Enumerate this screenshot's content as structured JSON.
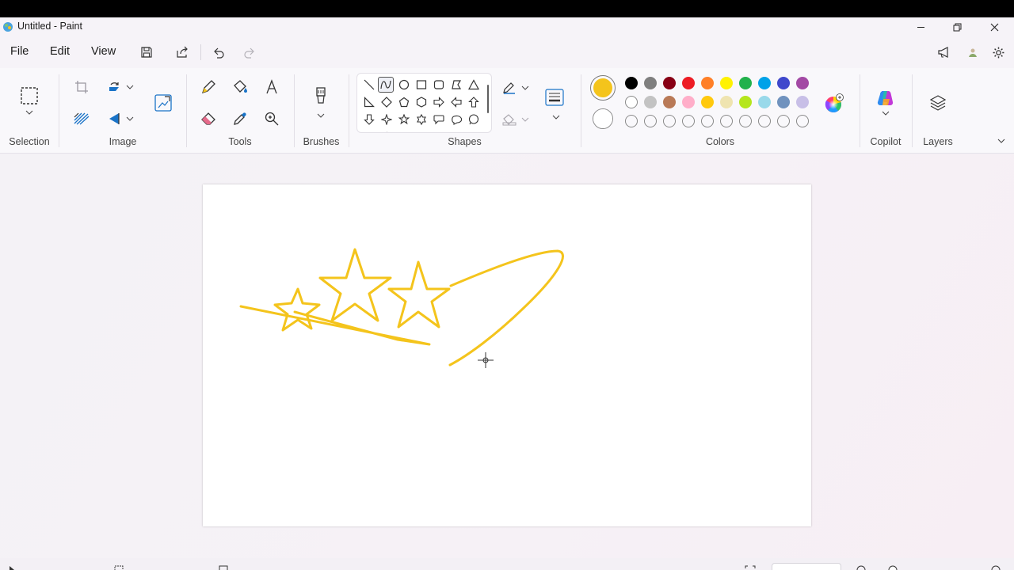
{
  "window": {
    "title": "Untitled - Paint",
    "controls": [
      "minimize",
      "restore",
      "close"
    ]
  },
  "menu": {
    "file": "File",
    "edit": "Edit",
    "view": "View"
  },
  "ribbon": {
    "groups": {
      "selection": "Selection",
      "image": "Image",
      "tools": "Tools",
      "brushes": "Brushes",
      "shapes": "Shapes",
      "colors": "Colors",
      "copilot": "Copilot",
      "layers": "Layers"
    },
    "colors": {
      "primary": "#f4c41c",
      "secondary": "#ffffff",
      "palette_row1": [
        "#000000",
        "#7f7f7f",
        "#880015",
        "#ed1c24",
        "#ff7f27",
        "#fff200",
        "#22b14c",
        "#00a2e8",
        "#3f48cc",
        "#a349a4"
      ],
      "palette_row2": [
        "#ffffff",
        "#c3c3c3",
        "#b97a57",
        "#ffaec9",
        "#ffc90e",
        "#efe4b0",
        "#b5e61d",
        "#99d9ea",
        "#7092be",
        "#c8bfe7"
      ],
      "custom_row_count": 10
    }
  },
  "canvas": {
    "stroke_color": "#f4c41c",
    "drawing": "yellow shooting stars"
  }
}
